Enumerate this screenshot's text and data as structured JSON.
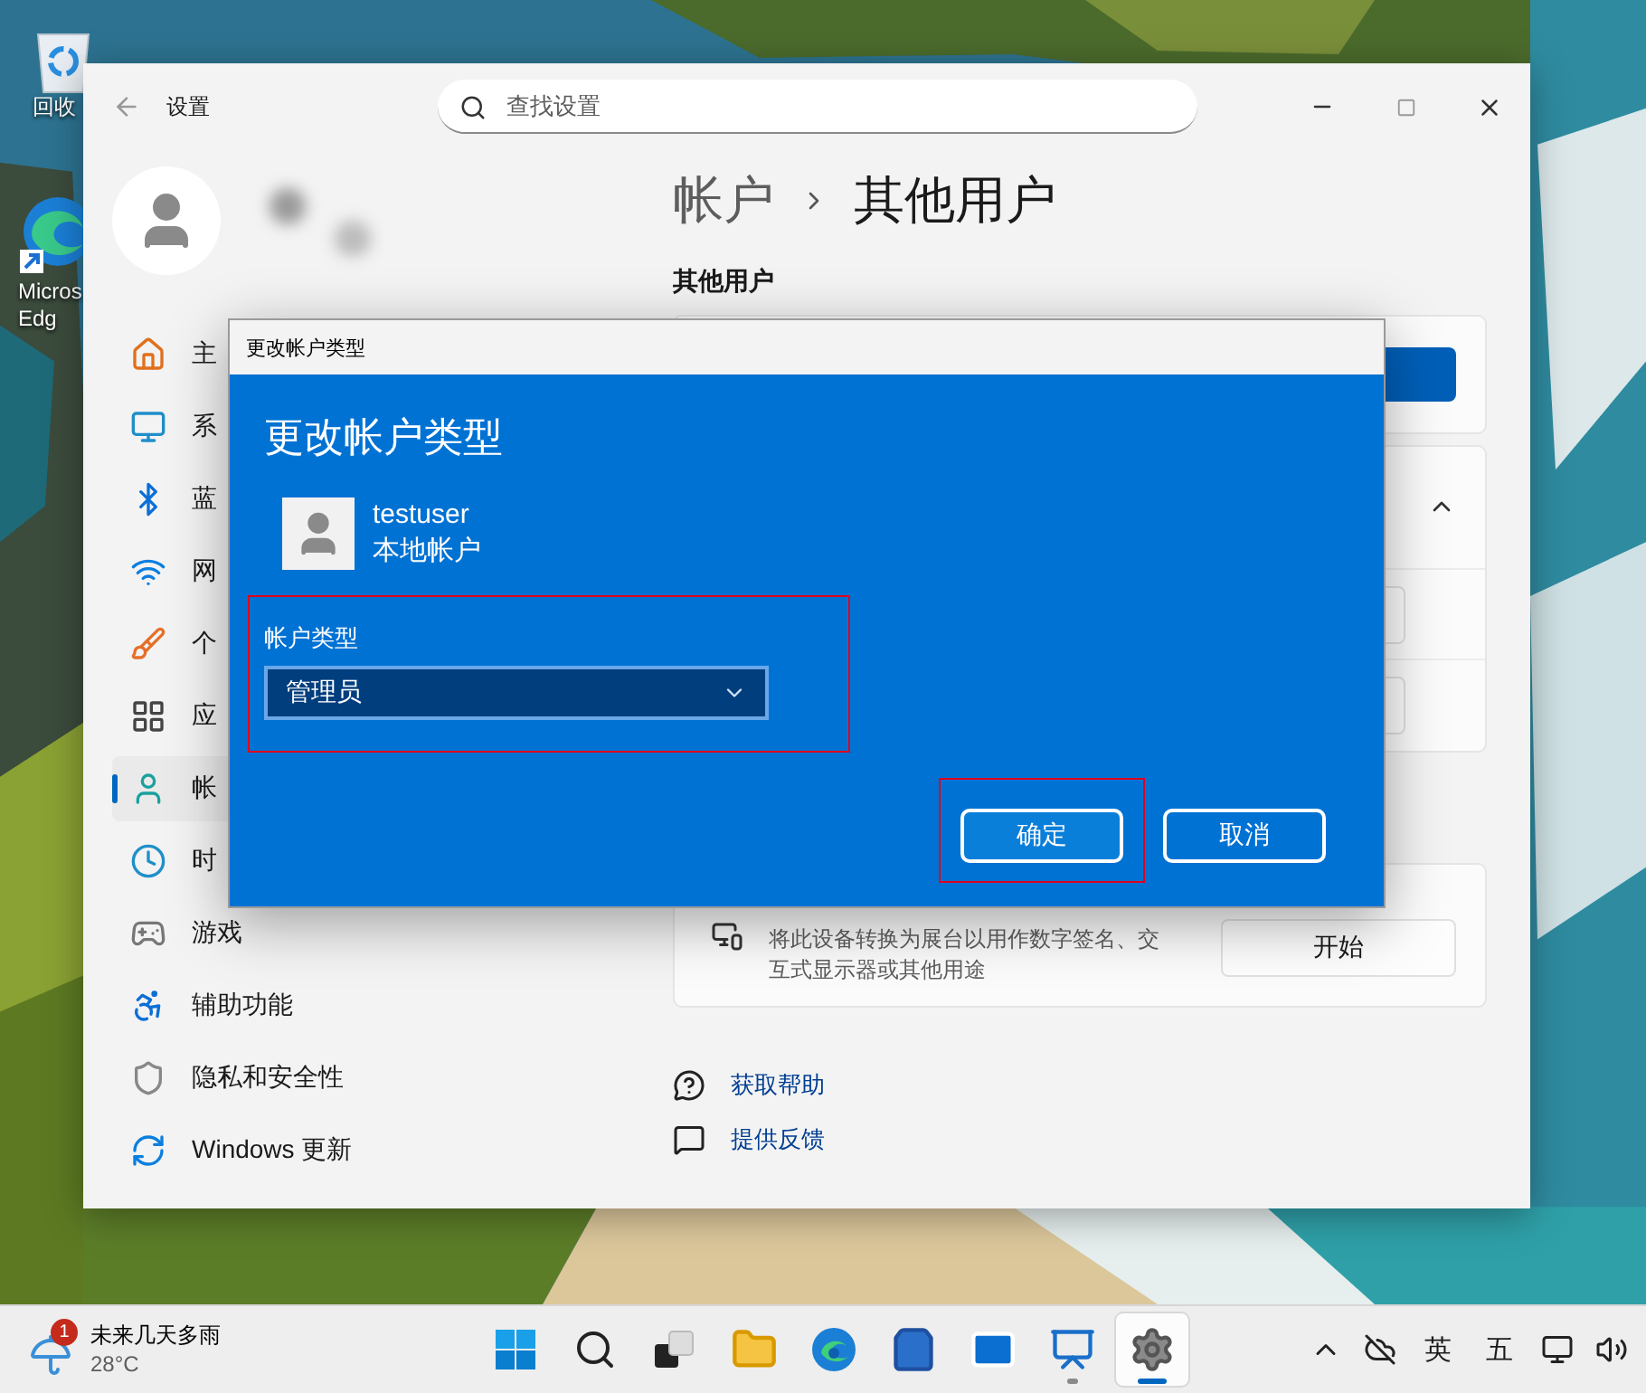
{
  "desktop": {
    "icons": [
      {
        "lines": [
          "回收"
        ]
      },
      {
        "lines": [
          "Micros",
          "Edg"
        ]
      }
    ]
  },
  "settings_window": {
    "title": "设置",
    "search": {
      "placeholder": "查找设置"
    },
    "sidebar": {
      "items": [
        {
          "label": "主",
          "selected": false
        },
        {
          "label": "系",
          "selected": false
        },
        {
          "label": "蓝",
          "selected": false
        },
        {
          "label": "网",
          "selected": false
        },
        {
          "label": "个",
          "selected": false
        },
        {
          "label": "应",
          "selected": false
        },
        {
          "label": "帐",
          "selected": true
        },
        {
          "label": "时",
          "selected": false
        },
        {
          "label": "游戏",
          "selected": false
        },
        {
          "label": "辅助功能",
          "selected": false
        },
        {
          "label": "隐私和安全性",
          "selected": false
        },
        {
          "label": "Windows 更新",
          "selected": false
        }
      ]
    },
    "breadcrumb": {
      "parent": "帐户",
      "current": "其他用户"
    },
    "section_title": "其他用户",
    "kiosk": {
      "description": "将此设备转换为展台以用作数字签名、交互式显示器或其他用途",
      "button": "开始"
    },
    "links": [
      "获取帮助",
      "提供反馈"
    ]
  },
  "dialog": {
    "title_bar": "更改帐户类型",
    "heading": "更改帐户类型",
    "user": {
      "name": "testuser",
      "type": "本地帐户"
    },
    "field": {
      "label": "帐户类型",
      "value": "管理员",
      "highlighted": true
    },
    "buttons": [
      {
        "label": "确定",
        "highlighted": true
      },
      {
        "label": "取消",
        "highlighted": false
      }
    ]
  },
  "taskbar": {
    "weather": {
      "badge": "1",
      "text": "未来几天多雨",
      "temperature": "28°C"
    },
    "apps": [
      {
        "kind": "start",
        "running": false,
        "selected": false
      },
      {
        "kind": "search",
        "running": false,
        "selected": false
      },
      {
        "kind": "task_view",
        "running": false,
        "selected": false
      },
      {
        "kind": "folder",
        "running": false,
        "selected": false
      },
      {
        "kind": "browser",
        "running": false,
        "selected": false
      },
      {
        "kind": "store",
        "running": false,
        "selected": false
      },
      {
        "kind": "mail",
        "running": false,
        "selected": false
      },
      {
        "kind": "chart",
        "running": true,
        "selected": false
      },
      {
        "kind": "settings",
        "running": true,
        "selected": true
      }
    ],
    "tray": {
      "language": "英",
      "ime": "五"
    }
  }
}
